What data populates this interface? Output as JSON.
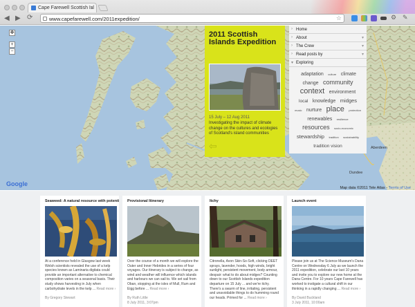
{
  "browser": {
    "tab_title": "Cape Farewell Scottish Isl",
    "tab_close": "×",
    "url": "www.capefarewell.com/2011expedition/",
    "back": "◀",
    "forward": "▶",
    "reload": "⟳",
    "star": "☆",
    "new_tab": "+"
  },
  "map": {
    "zoom_in": "+",
    "zoom_out": "−",
    "google_logo": "Google",
    "powered_by": "POWERED BY",
    "attribution": "Map data ©2011 Tele Atlas -",
    "terms_link": "Terms of Use",
    "cities": {
      "aberdeen": "Aberdeen",
      "dundee": "Dundee"
    }
  },
  "panel": {
    "title": "2011 Scottish Islands Expedition",
    "date": "15 July – 12 Aug 2011",
    "description": "Investigating the impact of climate change on the cultures and ecologies of Scotland's island communities",
    "arrow": "⇦",
    "background": "#d9e31a"
  },
  "menu": {
    "items": [
      {
        "label": "Home"
      },
      {
        "label": "About"
      },
      {
        "label": "The Crew"
      },
      {
        "label": "Read posts by"
      },
      {
        "label": "Exploring"
      }
    ],
    "tags": [
      {
        "text": "adaptation",
        "size": 7
      },
      {
        "text": "culture",
        "size": 4
      },
      {
        "text": "climate change",
        "size": 7
      },
      {
        "text": "community",
        "size": 9
      },
      {
        "text": "context",
        "size": 11
      },
      {
        "text": "environment",
        "size": 7
      },
      {
        "text": "local",
        "size": 6.5
      },
      {
        "text": "knowledge",
        "size": 7
      },
      {
        "text": "midges",
        "size": 7.5
      },
      {
        "text": "music",
        "size": 4
      },
      {
        "text": "nurture",
        "size": 7
      },
      {
        "text": "place",
        "size": 11
      },
      {
        "text": "protection",
        "size": 4
      },
      {
        "text": "renewables",
        "size": 7
      },
      {
        "text": "resilience",
        "size": 4
      },
      {
        "text": "resources",
        "size": 9
      },
      {
        "text": "socio-economic",
        "size": 4
      },
      {
        "text": "stewardship",
        "size": 7.5
      },
      {
        "text": "tradition",
        "size": 4
      },
      {
        "text": "sustainability",
        "size": 4
      },
      {
        "text": "tradition vision",
        "size": 6.5
      }
    ]
  },
  "cards": [
    {
      "title": "Seaweed: A natural resource with potential",
      "text": "At a conference held in Glasgow last week Welsh scientists revealed the use of a kelp species known as Laminaria digitata could provide an important alternative to chemical composition varies on a seasonal basis. Their study shows harvesting in July when carbohydrate levels in the kelp ...",
      "more": "Read more ›",
      "author": "By Gregory Stewart",
      "date": ""
    },
    {
      "title": "Provisional Itinerary",
      "text": "Over the course of a month we will explore the Outer and Inner Hebrides in a series of four voyages. Our itinerary is subject to change, as wind and weather will influence which islands and harbours we can sail to. We set sail from Oban, stopping at the isles of Mull, Rum and Eigg before ...",
      "more": "Read more ›",
      "author": "By Ruth Little",
      "date": "8 July 2011, 3:07pm"
    },
    {
      "title": "Itchy",
      "text": "Citronella, Avon Skin-So-Soft, clicking DEET sprays, lavender, hoods, high winds, bright sunlight, persistent movement, body armour, despair: what to do about midges? Counting down to our Scottish Islands expedition departure on 15 July ... and we're itchy. There's a swarm of line, irritating, persistent and unavoidable things to do humming round our heads. Primed for ...",
      "more": "Read more ›",
      "author": "",
      "date": ""
    },
    {
      "title": "Launch event",
      "text": "Please join us at The Science Museum's Dana Centre on Wednesday 6 July as we launch the 2011 expedition, celebrate our last 10 years and invite you to explore our new home at the Dana Centre. For 10 years Cape Farewell has worked to instigate a cultural shift in our thinking in a rapidly changing ...",
      "more": "Read more ›",
      "author": "By David Buckland",
      "date": "3 July 2011, 10:00am"
    }
  ]
}
